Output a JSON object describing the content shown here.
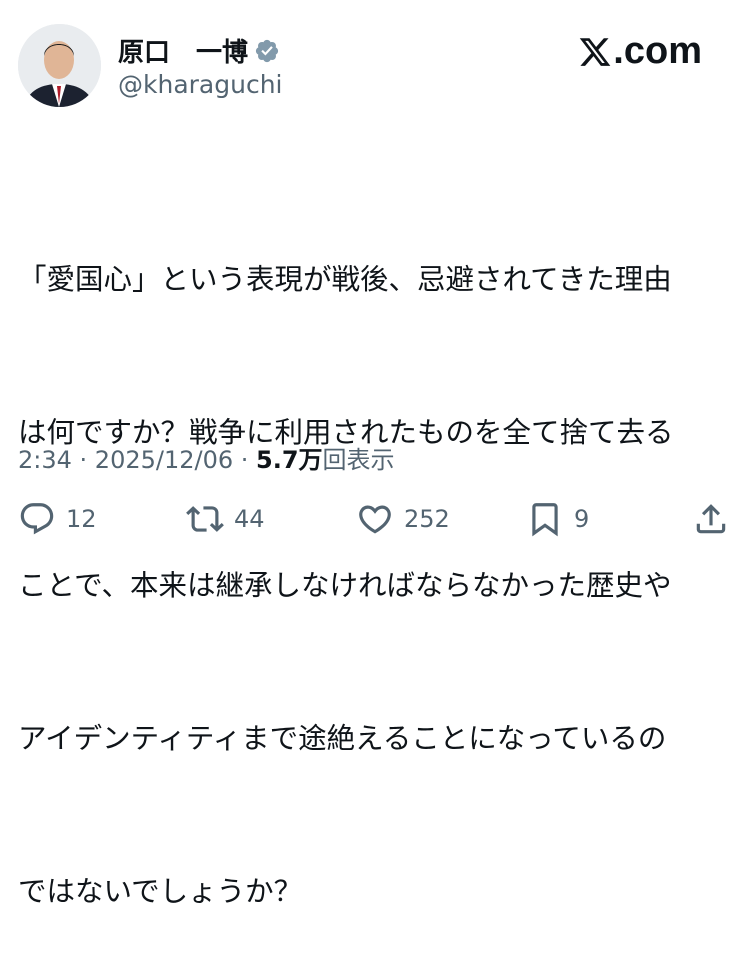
{
  "author": {
    "display_name": "原口　一博",
    "handle": "@kharaguchi",
    "verified": true
  },
  "brand": {
    "text": ".com",
    "logo": "x-logo-icon"
  },
  "tweet": {
    "lines": [
      "「愛国心」という表現が戦後、忌避されてきた理由",
      "は何ですか？戦争に利用されたものを全て捨て去る",
      "ことで、本来は継承しなければならなかった歴史や",
      "アイデンティティまで途絶えることになっているの",
      "ではないでしょうか？"
    ]
  },
  "meta": {
    "time": "2:34",
    "date": "2025/12/06",
    "views_count": "5.7万",
    "views_label": "回表示"
  },
  "actions": {
    "replies": "12",
    "retweets": "44",
    "likes": "252",
    "bookmarks": "9"
  },
  "colors": {
    "text": "#0f1419",
    "secondary": "#536471",
    "verified_badge": "#829aab"
  }
}
